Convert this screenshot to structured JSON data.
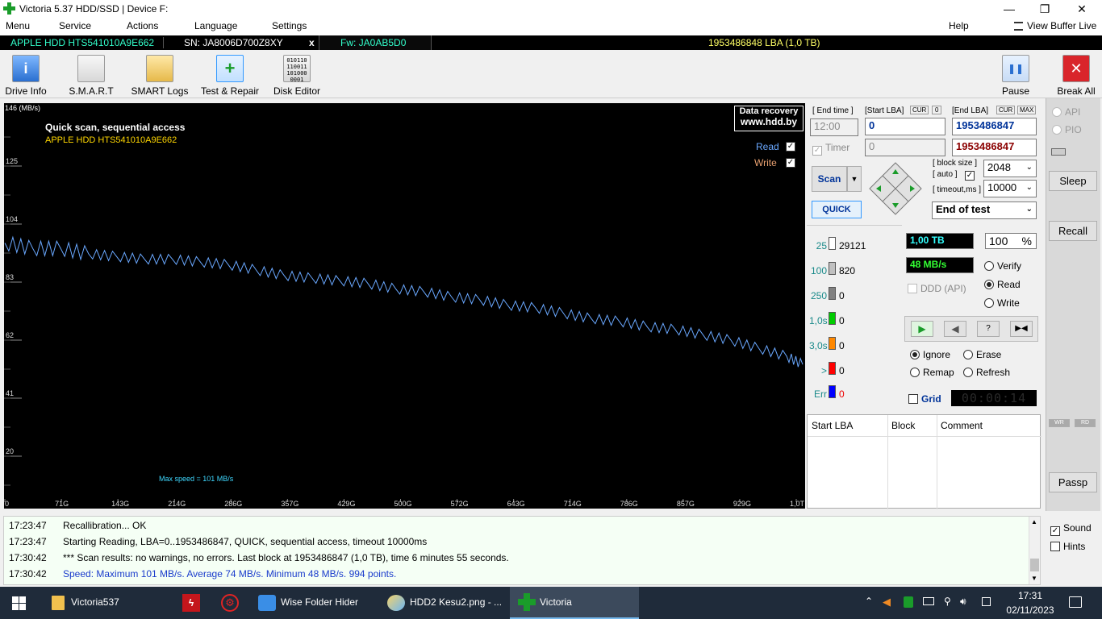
{
  "window": {
    "title": "Victoria 5.37 HDD/SSD | Device F:",
    "controls": [
      "—",
      "❐",
      "✕"
    ]
  },
  "menu": {
    "items": [
      "Menu",
      "Service",
      "Actions",
      "Language",
      "Settings"
    ],
    "help": "Help",
    "view_buffer": "View Buffer Live"
  },
  "infobar": {
    "model": "APPLE HDD HTS541010A9E662",
    "serial": "SN: JA8006D700Z8XY",
    "close": "x",
    "firmware": "Fw: JA0AB5D0",
    "capacity": "1953486848 LBA (1,0 TB)"
  },
  "toolbar": {
    "buttons": [
      "Drive Info",
      "S.M.A.R.T",
      "SMART Logs",
      "Test & Repair",
      "Disk Editor"
    ],
    "pause": "Pause",
    "break_all": "Break All"
  },
  "chart_data": {
    "type": "line",
    "title": "Quick scan, sequential access",
    "subtitle": "APPLE HDD HTS541010A9E662",
    "ylabel": "146 (MB/s)",
    "y_ticks": [
      "125",
      "104",
      "83",
      "62",
      "41",
      "20"
    ],
    "x_ticks": [
      "0",
      "71G",
      "143G",
      "214G",
      "286G",
      "357G",
      "429G",
      "500G",
      "572G",
      "643G",
      "714G",
      "786G",
      "857G",
      "929G",
      "1,0T"
    ],
    "ylim": [
      0,
      146
    ],
    "xlim": [
      0,
      1000
    ],
    "series": [
      {
        "name": "Read",
        "color": "#6aa8ff",
        "x": [
          0,
          35,
          70,
          105,
          140,
          175,
          210,
          245,
          280,
          315,
          350,
          385,
          420,
          455,
          490,
          525,
          560,
          595,
          630,
          665,
          700,
          735,
          770,
          805,
          840,
          875,
          910,
          945,
          980,
          1000
        ],
        "values": [
          96,
          94,
          94,
          92,
          91,
          90,
          90,
          89,
          88,
          86,
          84,
          83,
          82,
          81,
          79,
          78,
          76,
          75,
          73,
          72,
          70,
          68,
          67,
          65,
          64,
          62,
          60,
          57,
          54,
          51
        ]
      }
    ],
    "legend": [
      {
        "label": "Read",
        "checked": true,
        "color": "#6aa8ff"
      },
      {
        "label": "Write",
        "checked": true,
        "color": "#e8a070"
      }
    ],
    "legend_position": "top-right",
    "annotation": "Max speed = 101 MB/s",
    "badge": [
      "Data recovery",
      "www.hdd.by"
    ]
  },
  "panel": {
    "end_time_label": "[ End time ]",
    "start_lba_label": "[Start LBA]",
    "end_lba_label": "[End LBA]",
    "cur": "CUR",
    "max": "MAX",
    "zero": "0",
    "end_time": "12:00",
    "start_lba": "0",
    "end_lba": "1953486847",
    "timer_label": "Timer",
    "timer_value": "0",
    "end_lba2": "1953486847",
    "scan": "Scan",
    "quick": "QUICK",
    "block_size_label": "[ block size ]",
    "auto_label": "[ auto ]",
    "block_size": "2048",
    "timeout_label": "[ timeout,ms ]",
    "timeout": "10000",
    "end_action": "End of test",
    "stats": [
      {
        "label": "25",
        "count": "29121",
        "color": "#ffffff"
      },
      {
        "label": "100",
        "count": "820",
        "color": "#c0c0c0"
      },
      {
        "label": "250",
        "count": "0",
        "color": "#808080"
      },
      {
        "label": "1,0s",
        "count": "0",
        "color": "#00cc00"
      },
      {
        "label": "3,0s",
        "count": "0",
        "color": "#ff8800"
      },
      {
        "label": ">",
        "count": "0",
        "color": "#ff0000"
      },
      {
        "label": "Err",
        "count": "0",
        "color": "#0000ff"
      }
    ],
    "size": "1,00 TB",
    "percent": "100",
    "percent_sign": "%",
    "speed": "48 MB/s",
    "ddd": "DDD (API)",
    "verify": "Verify",
    "read": "Read",
    "write": "Write",
    "ignore": "Ignore",
    "erase": "Erase",
    "remap": "Remap",
    "refresh": "Refresh",
    "grid": "Grid",
    "timer_display": "00:00:14",
    "table_headers": [
      "Start LBA",
      "Block",
      "Comment"
    ]
  },
  "rightcol": {
    "api": "API",
    "pio": "PIO",
    "sleep": "Sleep",
    "recall": "Recall",
    "wr": "WR",
    "rd": "RD",
    "passp": "Passp",
    "sound": "Sound",
    "hints": "Hints"
  },
  "log": [
    {
      "time": "17:23:47",
      "msg": "Recallibration... OK",
      "color": "#000"
    },
    {
      "time": "17:23:47",
      "msg": "Starting Reading, LBA=0..1953486847, QUICK, sequential access, timeout 10000ms",
      "color": "#000"
    },
    {
      "time": "17:30:42",
      "msg": "*** Scan results: no warnings, no errors. Last block at 1953486847 (1,0 TB), time 6 minutes 55 seconds.",
      "color": "#000"
    },
    {
      "time": "17:30:42",
      "msg": "Speed: Maximum 101 MB/s. Average 74 MB/s. Minimum 48 MB/s. 994 points.",
      "color": "#1a3ccc"
    }
  ],
  "taskbar": {
    "items": [
      "Victoria537",
      "Wise Folder Hider",
      "HDD2 Kesu2.png - ...",
      "Victoria"
    ],
    "time": "17:31",
    "date": "02/11/2023"
  }
}
